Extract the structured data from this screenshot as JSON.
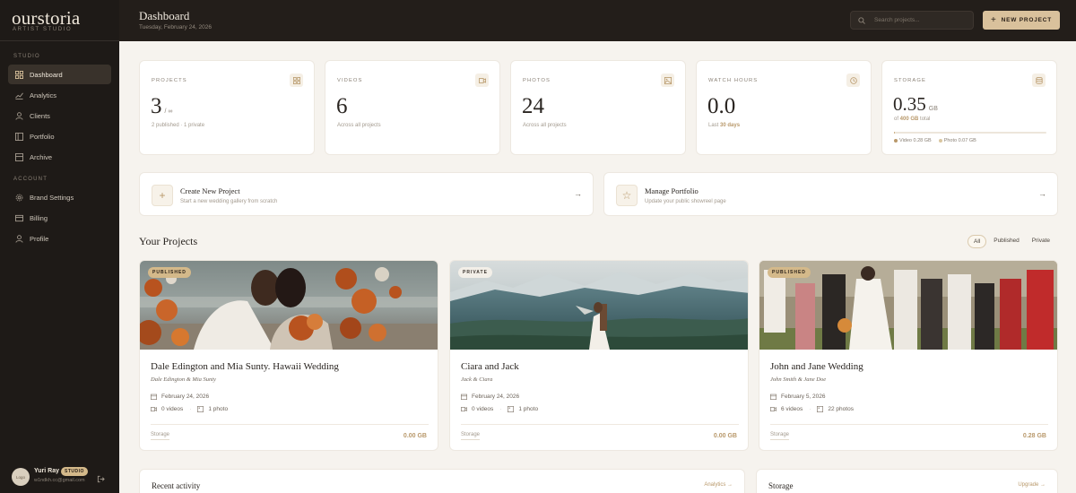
{
  "sidebar": {
    "logo": "ourstoria",
    "logo_sub": "ARTIST STUDIO",
    "section_studio": "STUDIO",
    "section_account": "ACCOUNT",
    "studio_items": [
      {
        "label": "Dashboard",
        "icon": "grid-icon",
        "active": true
      },
      {
        "label": "Analytics",
        "icon": "chart-icon"
      },
      {
        "label": "Clients",
        "icon": "user-icon"
      },
      {
        "label": "Portfolio",
        "icon": "book-icon"
      },
      {
        "label": "Archive",
        "icon": "archive-icon"
      }
    ],
    "account_items": [
      {
        "label": "Brand Settings",
        "icon": "gear-icon"
      },
      {
        "label": "Billing",
        "icon": "card-icon"
      },
      {
        "label": "Profile",
        "icon": "user-icon"
      }
    ],
    "user": {
      "name": "Yuri Ray",
      "badge": "STUDIO",
      "email": "w1ndkh.cc@gmail.com",
      "avatar_text": "Logo"
    }
  },
  "header": {
    "title": "Dashboard",
    "date": "Tuesday, February 24, 2026",
    "search_placeholder": "Search projects...",
    "new_button": "NEW PROJECT"
  },
  "stats": [
    {
      "label": "PROJECTS",
      "value": "3",
      "unit": "/ ∞",
      "sub": "2 published · 1 private",
      "icon": "grid-icon"
    },
    {
      "label": "VIDEOS",
      "value": "6",
      "unit": "",
      "sub": "Across all projects",
      "icon": "video-icon"
    },
    {
      "label": "PHOTOS",
      "value": "24",
      "unit": "",
      "sub": "Across all projects",
      "icon": "image-icon"
    },
    {
      "label": "WATCH HOURS",
      "value": "0.0",
      "unit": "",
      "sub_prefix": "Last ",
      "sub_bold": "30 days",
      "icon": "clock-icon"
    },
    {
      "label": "STORAGE",
      "value": "0.35",
      "unit": "GB",
      "sub_prefix": "of ",
      "sub_bold": "400 GB",
      "sub_suffix": " total",
      "icon": "database-icon",
      "used_fraction": 0.0009,
      "legend": [
        {
          "label": "Video 0.28 GB",
          "color": "#b8986a"
        },
        {
          "label": "Photo 0.07 GB",
          "color": "#d9c6a0"
        }
      ]
    }
  ],
  "actions": [
    {
      "title": "Create New Project",
      "sub": "Start a new wedding gallery from scratch",
      "icon": "plus-icon"
    },
    {
      "title": "Manage Portfolio",
      "sub": "Update your public showreel page",
      "icon": "star-icon"
    }
  ],
  "projects_section": {
    "title": "Your Projects",
    "filters": [
      "All",
      "Published",
      "Private"
    ],
    "active_filter": "All"
  },
  "projects": [
    {
      "badge": "PUBLISHED",
      "title": "Dale Edington and Mia Sunty. Hawaii Wedding",
      "subtitle": "Dale Edington & Mia Sunty",
      "date": "February 24, 2026",
      "videos": "0 videos",
      "photos": "1 photo",
      "storage_label": "Storage",
      "storage_value": "0.00 GB"
    },
    {
      "badge": "PRIVATE",
      "title": "Ciara and Jack",
      "subtitle": "Jack & Ciara",
      "date": "February 24, 2026",
      "videos": "0 videos",
      "photos": "1 photo",
      "storage_label": "Storage",
      "storage_value": "0.00 GB"
    },
    {
      "badge": "PUBLISHED",
      "title": "John and Jane Wedding",
      "subtitle": "John Smith & Jane Doe",
      "date": "February 5, 2026",
      "videos": "6 videos",
      "photos": "22 photos",
      "storage_label": "Storage",
      "storage_value": "0.28 GB"
    }
  ],
  "bottom": {
    "recent_title": "Recent activity",
    "recent_link": "Analytics →",
    "storage_title": "Storage",
    "storage_link": "Upgrade →"
  }
}
